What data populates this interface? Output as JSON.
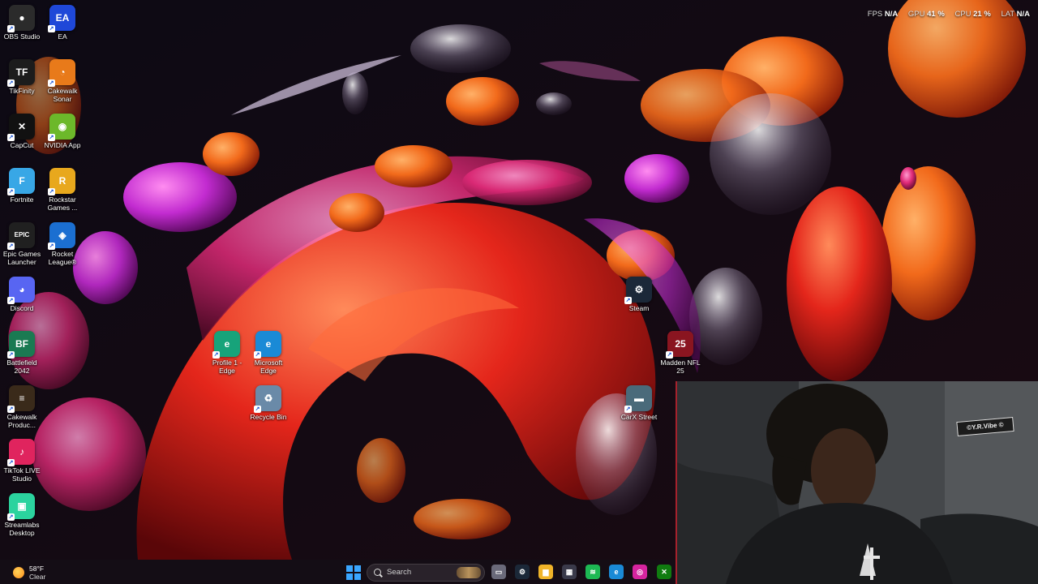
{
  "desktop": {
    "icons": [
      {
        "name": "obs-studio-icon",
        "label": "OBS Studio",
        "glyph": "●",
        "color": "#2b2b2b"
      },
      {
        "name": "ea-icon",
        "label": "EA",
        "glyph": "EA",
        "color": "#1f48d8"
      },
      {
        "name": "tikfinity-icon",
        "label": "TikFinity",
        "glyph": "TF",
        "color": "#1c1c1c"
      },
      {
        "name": "cakewalk-sonar-icon",
        "label": "Cakewalk Sonar",
        "glyph": "◔",
        "color": "#e87a1a"
      },
      {
        "name": "capcut-icon",
        "label": "CapCut",
        "glyph": "✕",
        "color": "#111111"
      },
      {
        "name": "nvidia-app-icon",
        "label": "NVIDIA App",
        "glyph": "◉",
        "color": "#6cb82a"
      },
      {
        "name": "fortnite-icon",
        "label": "Fortnite",
        "glyph": "F",
        "color": "#38a7e6"
      },
      {
        "name": "rockstar-games-icon",
        "label": "Rockstar Games ...",
        "glyph": "R",
        "color": "#e8a81d"
      },
      {
        "name": "epic-games-icon",
        "label": "Epic Games Launcher",
        "glyph": "EPIC",
        "color": "#202020"
      },
      {
        "name": "rocket-league-icon",
        "label": "Rocket League®",
        "glyph": "◈",
        "color": "#1b6fd1"
      },
      {
        "name": "discord-icon",
        "label": "Discord",
        "glyph": "◕",
        "color": "#5865f2"
      },
      {
        "name": "battlefield-icon",
        "label": "Battlefield 2042",
        "glyph": "BF",
        "color": "#1a7a52"
      },
      {
        "name": "cakewalk-product-icon",
        "label": "Cakewalk Produc...",
        "glyph": "≡",
        "color": "#3a2a1a"
      },
      {
        "name": "tiktok-live-studio-icon",
        "label": "TikTok LIVE Studio",
        "glyph": "♪",
        "color": "#e0245e"
      },
      {
        "name": "streamlabs-desktop-icon",
        "label": "Streamlabs Desktop",
        "glyph": "▣",
        "color": "#2bd39e"
      },
      {
        "name": "steam-icon",
        "label": "Steam",
        "glyph": "⚙",
        "color": "#1b2838"
      },
      {
        "name": "profile-1-edge-icon",
        "label": "Profile 1 - Edge",
        "glyph": "e",
        "color": "#17a37a"
      },
      {
        "name": "microsoft-edge-icon",
        "label": "Microsoft Edge",
        "glyph": "e",
        "color": "#1a8ad6"
      },
      {
        "name": "madden-nfl-25-icon",
        "label": "Madden NFL 25",
        "glyph": "25",
        "color": "#8a1520"
      },
      {
        "name": "recycle-bin-icon",
        "label": "Recycle Bin",
        "glyph": "♻",
        "color": "#6a8aa8"
      },
      {
        "name": "carx-street-icon",
        "label": "CarX Street",
        "glyph": "▬",
        "color": "#4a6a7a"
      }
    ]
  },
  "perf_overlay": {
    "fps_label": "FPS",
    "fps_value": "N/A",
    "gpu_label": "GPU",
    "gpu_value": "41 %",
    "cpu_label": "CPU",
    "cpu_value": "21 %",
    "lat_label": "LAT",
    "lat_value": "N/A"
  },
  "webcam": {
    "sign_text": "©Y.R.Vibe ©"
  },
  "taskbar": {
    "weather_temp": "58°F",
    "weather_condition": "Clear",
    "search_placeholder": "Search",
    "apps": [
      {
        "name": "task-view-icon",
        "glyph": "▭",
        "color": "#6a6a7a"
      },
      {
        "name": "steam-taskbar-icon",
        "glyph": "⚙",
        "color": "#1b2838"
      },
      {
        "name": "file-explorer-icon",
        "glyph": "▆",
        "color": "#f0b429"
      },
      {
        "name": "microsoft-store-icon",
        "glyph": "▦",
        "color": "#3a3a4a"
      },
      {
        "name": "spotify-icon",
        "glyph": "≋",
        "color": "#1db954"
      },
      {
        "name": "edge-taskbar-icon",
        "glyph": "e",
        "color": "#1a8ad6"
      },
      {
        "name": "instagram-icon",
        "glyph": "◎",
        "color": "#d6249f"
      },
      {
        "name": "xbox-icon",
        "glyph": "✕",
        "color": "#107c10"
      }
    ]
  }
}
